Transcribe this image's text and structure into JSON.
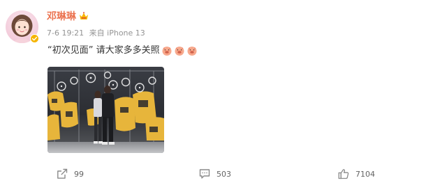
{
  "post": {
    "username": "邓琳琳",
    "time": "7-6 19:21",
    "source": "来自 iPhone 13",
    "text_before_emoji": "“初次见面” 请大家多多关照",
    "emojis": [
      "cute-pig-emoji",
      "cute-pig-emoji",
      "cute-pig-emoji"
    ]
  },
  "stats": {
    "forwards": "99",
    "comments": "503",
    "likes": "7104"
  },
  "colors": {
    "username": "#eb7350",
    "meta": "#939393",
    "text": "#333333",
    "verify": "#f5b500",
    "action": "#636363"
  },
  "icons": {
    "verify": "verified-badge-icon",
    "vip": "vip-crown-icon",
    "forward": "forward-icon",
    "comment": "comment-icon",
    "like": "thumbs-up-icon"
  }
}
